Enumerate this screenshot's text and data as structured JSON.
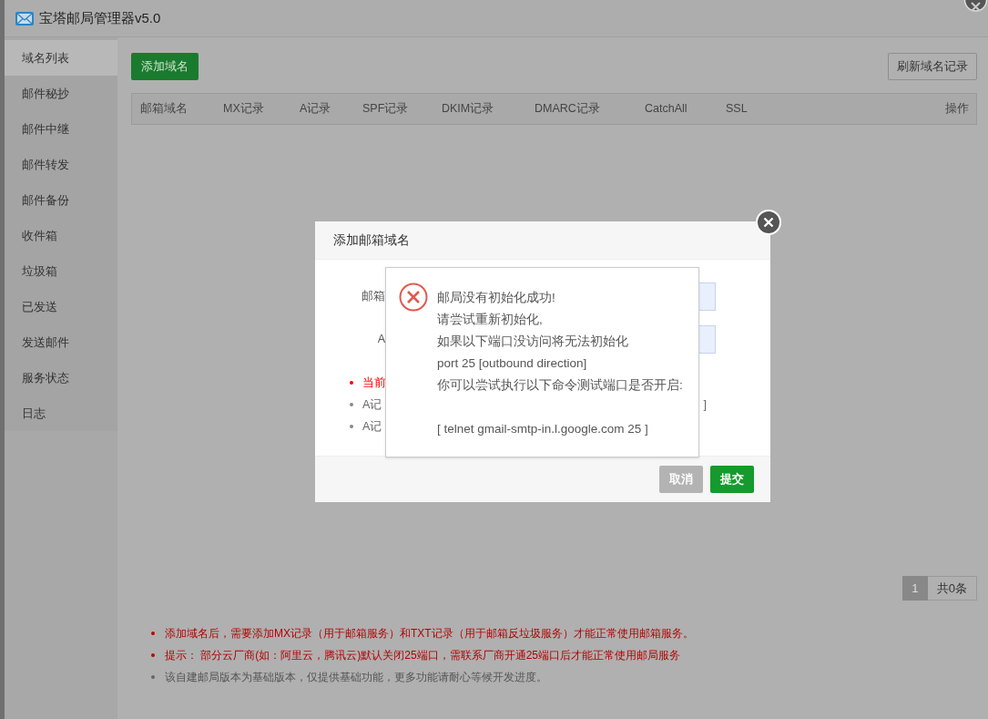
{
  "window": {
    "title": "宝塔邮局管理器v5.0"
  },
  "sidebar": {
    "items": [
      {
        "label": "域名列表",
        "selected": true
      },
      {
        "label": "邮件秘抄",
        "selected": false
      },
      {
        "label": "邮件中继",
        "selected": false
      },
      {
        "label": "邮件转发",
        "selected": false
      },
      {
        "label": "邮件备份",
        "selected": false
      },
      {
        "label": "收件箱",
        "selected": false
      },
      {
        "label": "垃圾箱",
        "selected": false
      },
      {
        "label": "已发送",
        "selected": false
      },
      {
        "label": "发送邮件",
        "selected": false
      },
      {
        "label": "服务状态",
        "selected": false
      },
      {
        "label": "日志",
        "selected": false
      }
    ]
  },
  "toolbar": {
    "add_button": "添加域名",
    "refresh_button": "刷新域名记录"
  },
  "table": {
    "columns": [
      "邮箱域名",
      "MX记录",
      "A记录",
      "SPF记录",
      "DKIM记录",
      "DMARC记录",
      "CatchAll",
      "SSL",
      "操作"
    ]
  },
  "pagination": {
    "pages": [
      {
        "label": "1",
        "selected": true
      }
    ],
    "total": "共0条"
  },
  "notes": [
    {
      "text": "添加域名后，需要添加MX记录（用于邮箱服务）和TXT记录（用于邮箱反垃圾服务）才能正常使用邮箱服务。",
      "kind": "warning"
    },
    {
      "text": "提示： 部分云厂商(如：阿里云，腾讯云)默认关闭25端口，需联系厂商开通25端口后才能正常使用邮局服务",
      "kind": "warning"
    },
    {
      "text": "该自建邮局版本为基础版本，仅提供基础功能，更多功能请耐心等候开发进度。",
      "kind": "info"
    }
  ],
  "dialog": {
    "title": "添加邮箱域名",
    "fields": [
      {
        "label": "邮箱"
      },
      {
        "label": "A"
      }
    ],
    "notes": [
      {
        "text": "当前",
        "kind": "warning"
      },
      {
        "text": "A记",
        "kind": "info",
        "tail": "]"
      },
      {
        "text": "A记",
        "kind": "info"
      }
    ],
    "buttons": [
      {
        "label": "取消",
        "kind": "secondary"
      },
      {
        "label": "提交",
        "kind": "primary"
      }
    ]
  },
  "alert": {
    "lines": [
      {
        "text": "邮局没有初始化成功!",
        "kind": "text"
      },
      {
        "text": "请尝试重新初始化,",
        "kind": "text"
      },
      {
        "text": "如果以下端口没访问将无法初始化",
        "kind": "text"
      },
      {
        "text": "port 25 [outbound direction]",
        "kind": "text"
      },
      {
        "text": "你可以尝试执行以下命令测试端口是否开启:",
        "kind": "text"
      },
      {
        "text": "[ telnet gmail-smtp-in.l.google.com 25 ]",
        "kind": "command"
      }
    ]
  }
}
